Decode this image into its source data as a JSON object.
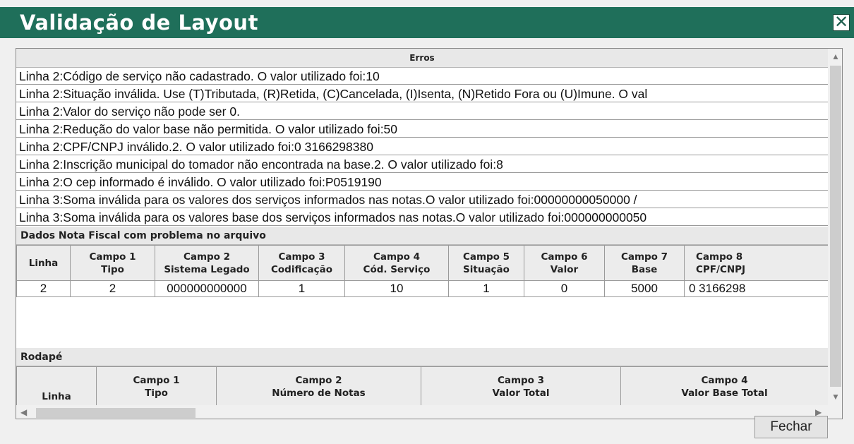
{
  "window": {
    "title": "Validação de Layout",
    "close_glyph": "✕"
  },
  "errors": {
    "header": "Erros",
    "rows": [
      "Linha 2:Código de serviço não cadastrado. O valor utilizado foi:10",
      "Linha 2:Situação inválida. Use (T)Tributada, (R)Retida, (C)Cancelada, (I)Isenta, (N)Retido Fora ou (U)Imune. O val",
      "Linha 2:Valor do serviço não pode ser 0.",
      "Linha 2:Redução do valor base não permitida. O valor utilizado foi:50",
      "Linha 2:CPF/CNPJ inválido.2. O valor utilizado foi:0 3166298380",
      "Linha 2:Inscrição municipal do tomador não encontrada na base.2. O valor utilizado foi:8",
      "Linha 2:O cep informado é inválido. O valor utilizado foi:P0519190",
      "Linha 3:Soma inválida para os valores dos serviços informados nas notas.O valor utilizado foi:00000000050000 /",
      "Linha 3:Soma inválida para os valores base dos serviços informados nas notas.O valor utilizado foi:000000000050"
    ]
  },
  "nota_fiscal": {
    "section_title": "Dados Nota Fiscal com problema no arquivo",
    "columns": [
      [
        "Linha",
        ""
      ],
      [
        "Campo 1",
        "Tipo"
      ],
      [
        "Campo 2",
        "Sistema Legado"
      ],
      [
        "Campo 3",
        "Codificação"
      ],
      [
        "Campo 4",
        "Cód. Serviço"
      ],
      [
        "Campo 5",
        "Situação"
      ],
      [
        "Campo 6",
        "Valor"
      ],
      [
        "Campo 7",
        "Base"
      ],
      [
        "Campo 8",
        "CPF/CNPJ"
      ]
    ],
    "rows": [
      [
        "2",
        "2",
        "000000000000",
        "1",
        "10",
        "1",
        "0",
        "5000",
        "0 3166298"
      ]
    ]
  },
  "rodape": {
    "section_title": "Rodapé",
    "columns": [
      [
        "Linha",
        ""
      ],
      [
        "Campo 1",
        "Tipo"
      ],
      [
        "Campo 2",
        "Número de Notas"
      ],
      [
        "Campo 3",
        "Valor Total"
      ],
      [
        "Campo 4",
        "Valor Base Total"
      ]
    ]
  },
  "scrollbar": {
    "up": "▲",
    "down": "▼",
    "left": "◀",
    "right": "▶"
  },
  "buttons": {
    "close_label": "Fechar"
  }
}
